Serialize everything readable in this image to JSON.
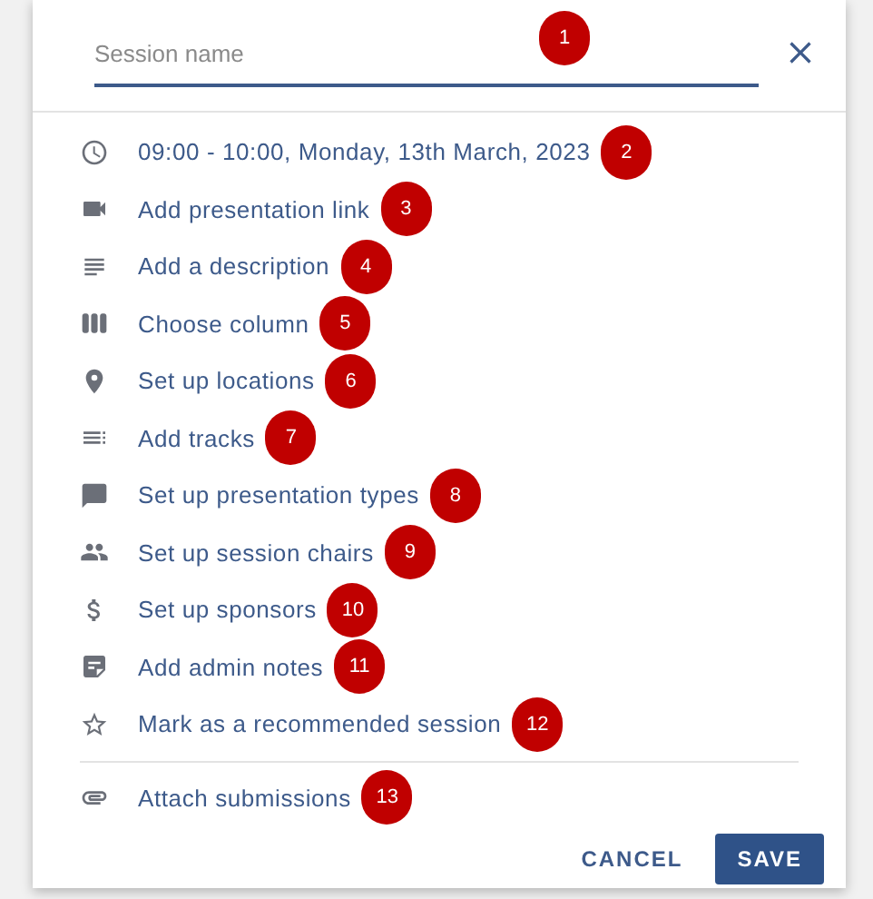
{
  "session_name": {
    "placeholder": "Session name",
    "marker": "1"
  },
  "items": [
    {
      "label": "09:00 - 10:00, Monday, 13th March, 2023",
      "marker": "2"
    },
    {
      "label": "Add presentation link",
      "marker": "3"
    },
    {
      "label": "Add a description",
      "marker": "4"
    },
    {
      "label": "Choose column",
      "marker": "5"
    },
    {
      "label": "Set up locations",
      "marker": "6"
    },
    {
      "label": "Add tracks",
      "marker": "7"
    },
    {
      "label": "Set up presentation types",
      "marker": "8"
    },
    {
      "label": "Set up session chairs",
      "marker": "9"
    },
    {
      "label": "Set up sponsors",
      "marker": "10"
    },
    {
      "label": "Add admin notes",
      "marker": "11"
    },
    {
      "label": "Mark as a recommended session",
      "marker": "12"
    }
  ],
  "extra_items": [
    {
      "label": "Attach submissions",
      "marker": "13"
    }
  ],
  "buttons": [
    {
      "label": "CANCEL",
      "kind": "text"
    },
    {
      "label": "SAVE",
      "kind": "primary"
    }
  ]
}
